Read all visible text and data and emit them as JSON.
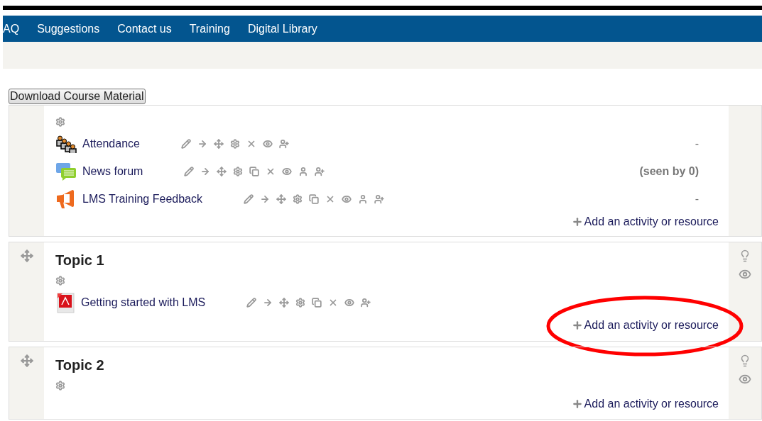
{
  "nav": {
    "items": [
      "AQ",
      "Suggestions",
      "Contact us",
      "Training",
      "Digital Library"
    ]
  },
  "download_button": "Download Course Material",
  "sections": [
    {
      "drag": false,
      "side_icons": false,
      "activities": [
        {
          "kind": "attendance",
          "name": "Attendance",
          "actions": [
            {
              "kind": "edit"
            },
            {
              "kind": "indent"
            },
            {
              "kind": "move"
            },
            {
              "kind": "settings"
            },
            {
              "kind": "delete"
            },
            {
              "kind": "hide"
            },
            {
              "kind": "assign"
            }
          ],
          "status": "-"
        },
        {
          "kind": "forum",
          "name": "News forum",
          "actions": [
            {
              "kind": "edit"
            },
            {
              "kind": "indent"
            },
            {
              "kind": "move"
            },
            {
              "kind": "settings"
            },
            {
              "kind": "duplicate"
            },
            {
              "kind": "delete"
            },
            {
              "kind": "hide"
            },
            {
              "kind": "groups"
            },
            {
              "kind": "assign"
            }
          ],
          "status": "(seen by 0)"
        },
        {
          "kind": "feedback",
          "name": "LMS Training Feedback",
          "actions": [
            {
              "kind": "edit"
            },
            {
              "kind": "indent"
            },
            {
              "kind": "move"
            },
            {
              "kind": "settings"
            },
            {
              "kind": "duplicate"
            },
            {
              "kind": "delete"
            },
            {
              "kind": "hide"
            },
            {
              "kind": "groups"
            },
            {
              "kind": "assign"
            }
          ],
          "status": "-"
        }
      ],
      "add": {
        "label": "Add an activity or resource",
        "highlighted": false
      }
    },
    {
      "title": "Topic 1",
      "drag": true,
      "side_icons": true,
      "activities": [
        {
          "kind": "pdf",
          "name": "Getting started with LMS",
          "actions": [
            {
              "kind": "edit"
            },
            {
              "kind": "indent"
            },
            {
              "kind": "move"
            },
            {
              "kind": "settings"
            },
            {
              "kind": "duplicate"
            },
            {
              "kind": "delete"
            },
            {
              "kind": "hide"
            },
            {
              "kind": "assign"
            }
          ]
        }
      ],
      "add": {
        "label": "Add an activity or resource",
        "highlighted": true
      }
    },
    {
      "title": "Topic 2",
      "drag": true,
      "side_icons": true,
      "add": {
        "label": "Add an activity or resource",
        "highlighted": false
      }
    }
  ]
}
